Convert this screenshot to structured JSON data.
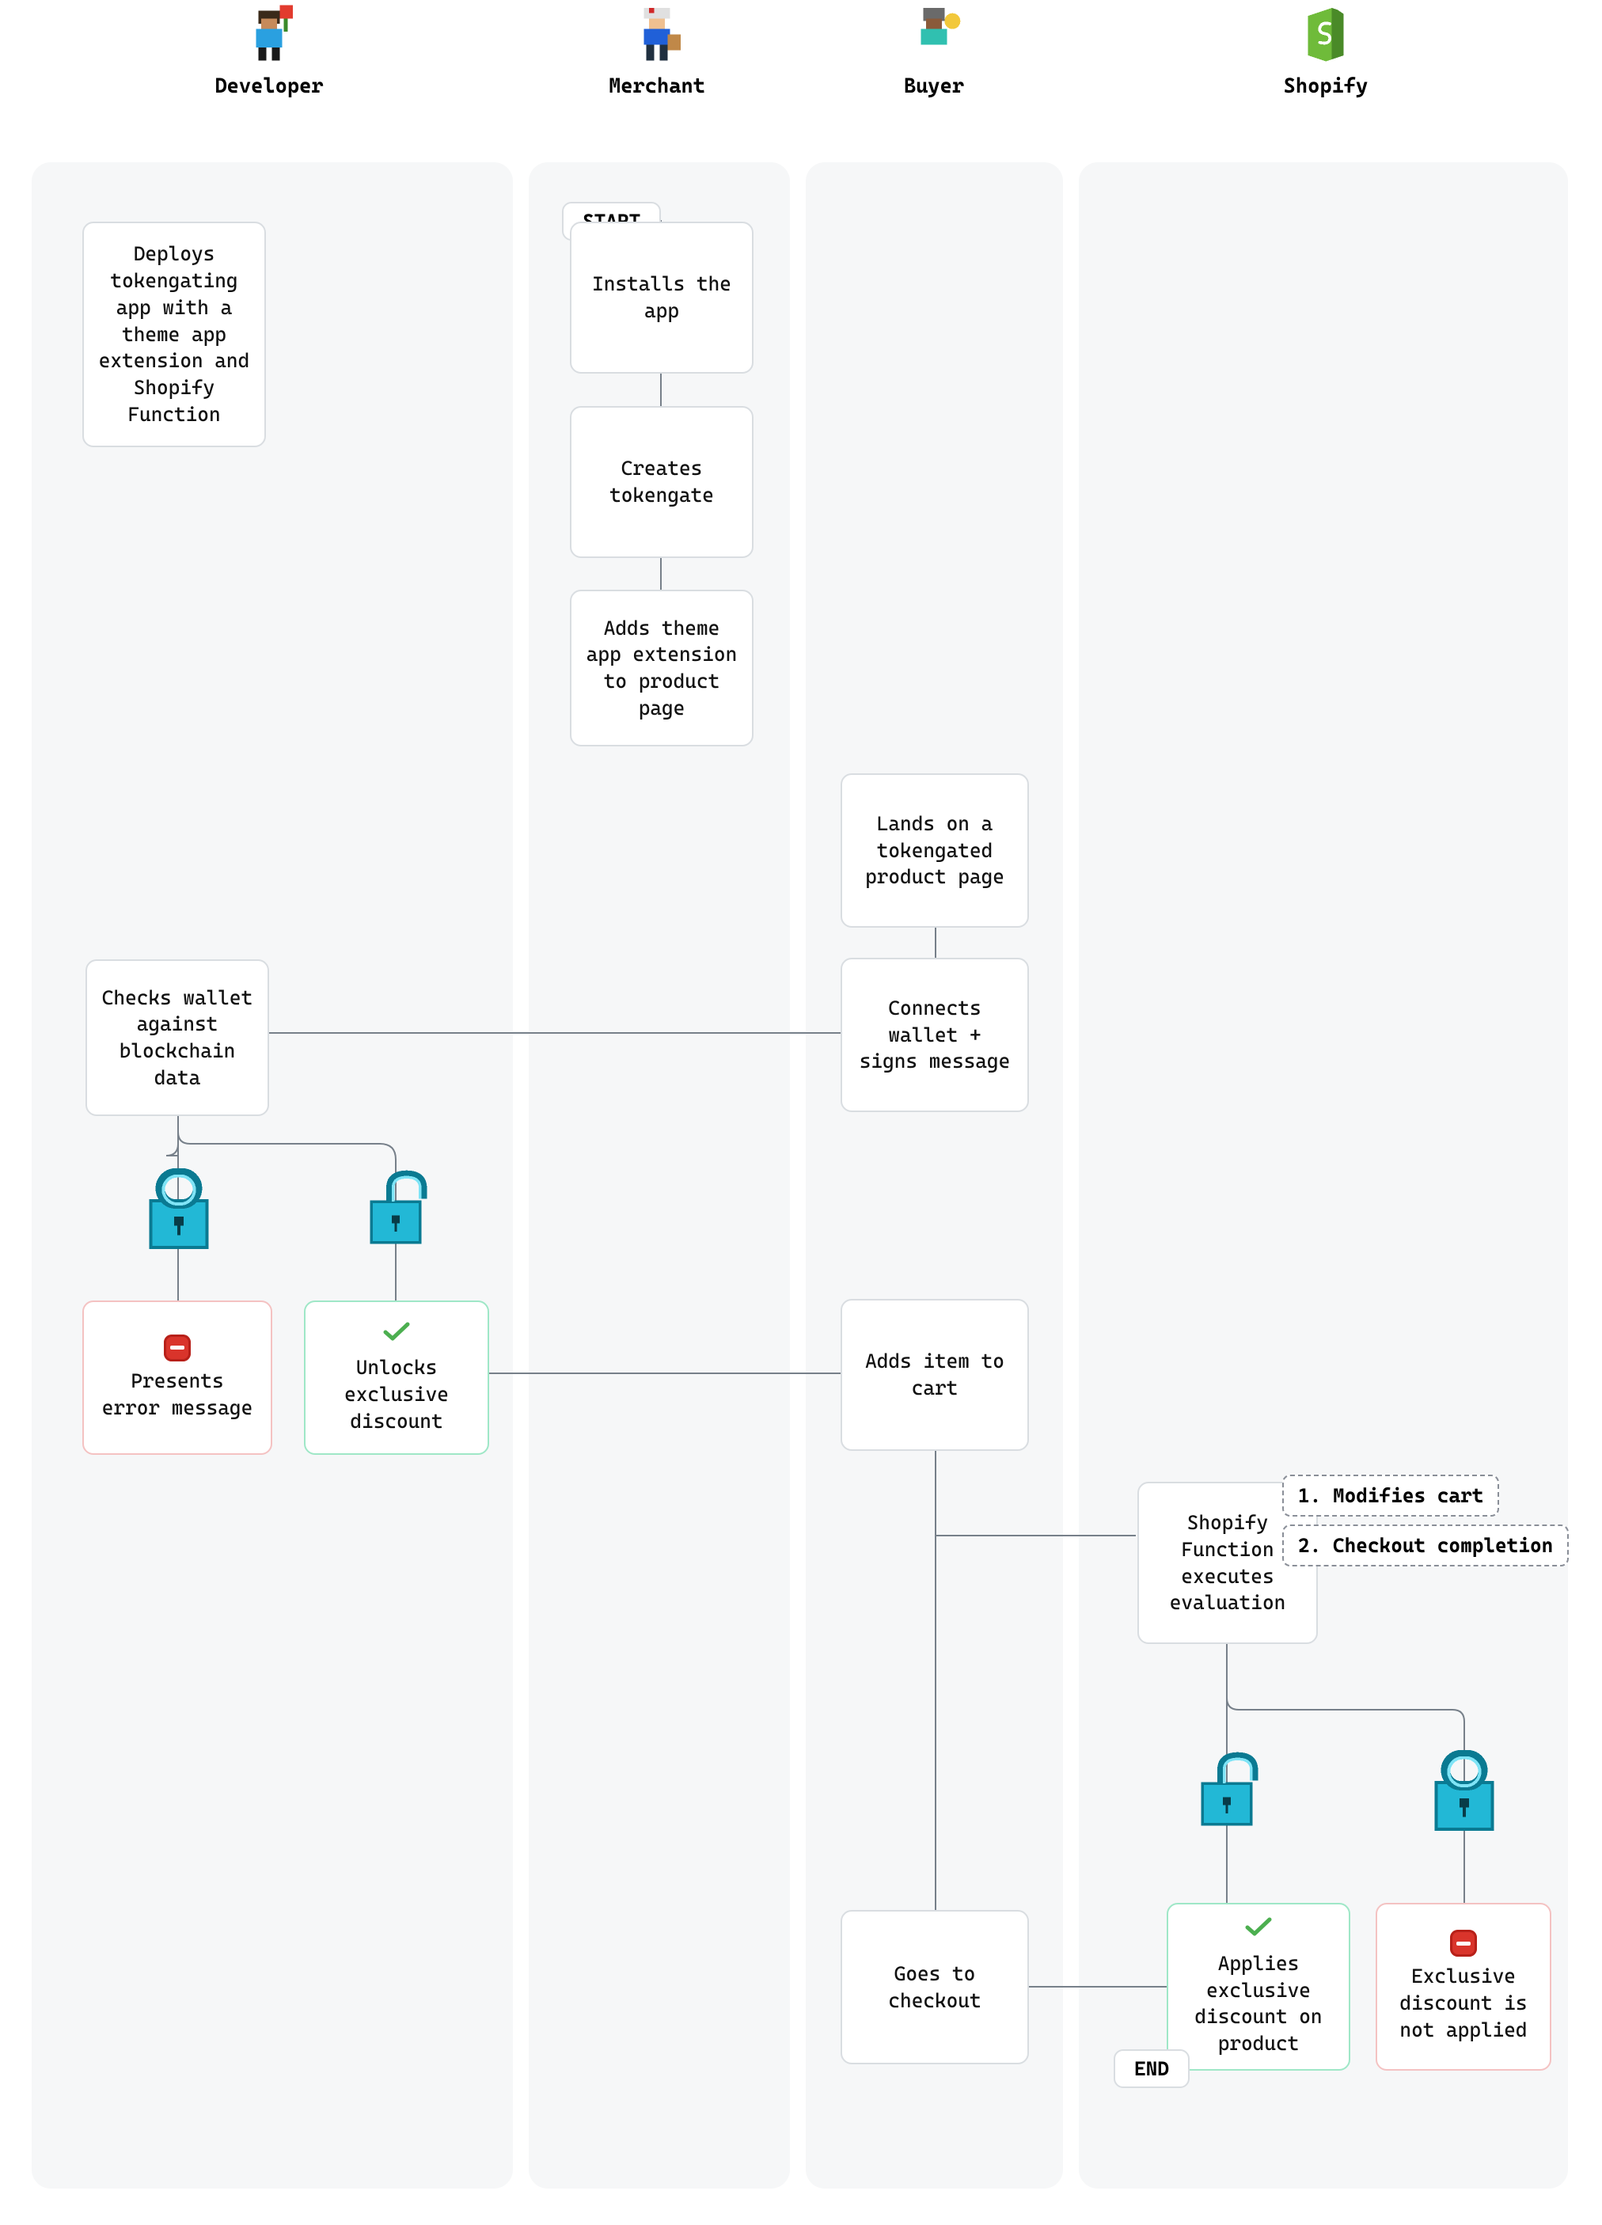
{
  "lanes": {
    "developer": "Developer",
    "merchant": "Merchant",
    "buyer": "Buyer",
    "shopify": "Shopify"
  },
  "pills": {
    "start": "START",
    "end": "END"
  },
  "nodes": {
    "dev_deploys": "Deploys tokengating app with a theme app extension and Shopify Function",
    "merchant_installs": "Installs the app",
    "merchant_creates": "Creates tokengate",
    "merchant_adds_ext": "Adds theme app extension to product page",
    "buyer_lands": "Lands on a tokengated product page",
    "buyer_connects": "Connects wallet + signs message",
    "dev_checks": "Checks wallet against blockchain data",
    "dev_error": "Presents error message",
    "dev_unlocks": "Unlocks exclusive discount",
    "buyer_addcart": "Adds item to cart",
    "shopify_eval": "Shopify Function executes evaluation",
    "shopify_side1": "1. Modifies cart",
    "shopify_side2": "2. Checkout completion",
    "buyer_checkout": "Goes to checkout",
    "shopify_applies": "Applies exclusive discount on product",
    "shopify_notapplied": "Exclusive discount is not applied"
  }
}
